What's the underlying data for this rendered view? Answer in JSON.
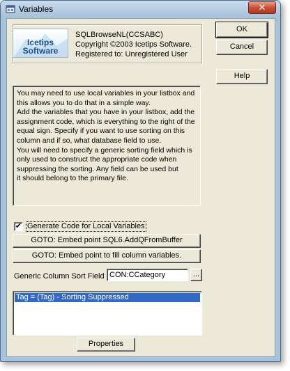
{
  "window": {
    "title": "Variables",
    "close_glyph": "✕"
  },
  "about": {
    "logo_line1": "Icetips",
    "logo_line2": "Software",
    "product": "SQLBrowseNL(CCSABC)",
    "copyright": "Copyright ©2003 Icetips Software.",
    "registration": "Registered to: Unregistered User"
  },
  "buttons": {
    "ok_label": "OK",
    "cancel_label": "Cancel",
    "help_label": "Help",
    "embed_sql_label": "GOTO: Embed point SQL6.AddQFromBuffer",
    "embed_fill_label": "GOTO: Embed point to fill column variables.",
    "properties_label": "Properties",
    "ellipsis_label": "..."
  },
  "description": {
    "lines": [
      "You may need to use local variables in your listbox and",
      "this allows you to do that in a simple way.",
      "Add the variables that you have in your listbox, add the",
      "assignment code, which is everything to the right of the",
      "equal sign.  Specify if you want to use sorting on this",
      "column and if so, what database field to use.",
      "You will need to specify a generic sorting field which is",
      "only used to construct the appropriate code when",
      "suppressing the sorting.  Any field can be used but",
      "it should belong to the primary file."
    ]
  },
  "generate_code": {
    "label": "Generate Code for Local Variables",
    "checked": true,
    "check_glyph": "✔"
  },
  "sort_field": {
    "label": "Generic Column Sort Field",
    "value": "CON:CCategory"
  },
  "variables_list": {
    "items": [
      "Tag = (Tag) - Sorting Suppressed"
    ],
    "selected_index": 0
  },
  "icons": {
    "app": "window-app-icon",
    "close": "close-icon"
  }
}
